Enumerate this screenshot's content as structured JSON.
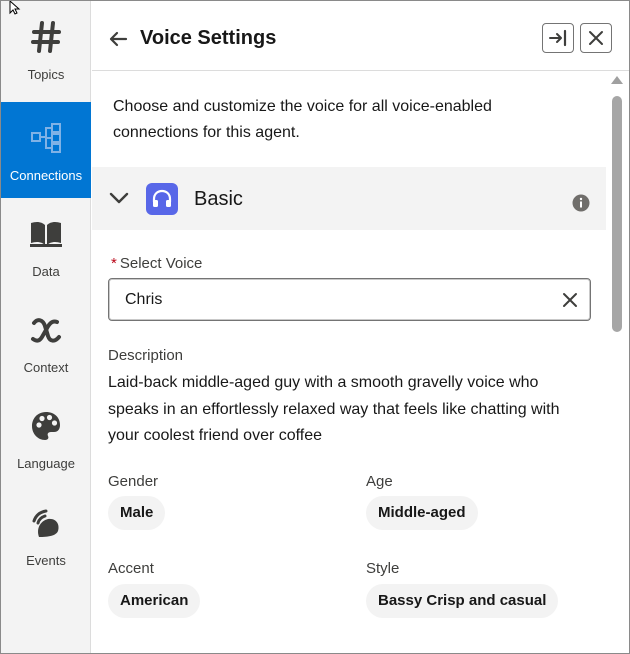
{
  "rail": {
    "items": [
      {
        "label": "Topics",
        "icon": "hash-icon",
        "active": false
      },
      {
        "label": "Connections",
        "icon": "connections-icon",
        "active": true
      },
      {
        "label": "Data",
        "icon": "book-icon",
        "active": false
      },
      {
        "label": "Context",
        "icon": "variable-x-icon",
        "active": false
      },
      {
        "label": "Language",
        "icon": "palette-icon",
        "active": false
      },
      {
        "label": "Events",
        "icon": "signal-icon",
        "active": false
      }
    ]
  },
  "header": {
    "title": "Voice Settings",
    "back_icon": "arrow-left-icon",
    "dock_icon": "dock-right-icon",
    "close_icon": "close-icon"
  },
  "intro": "Choose and customize the voice for all voice-enabled connections for this agent.",
  "section": {
    "title": "Basic",
    "icon": "headphones-icon",
    "icon_color": "#5867e8"
  },
  "select_voice": {
    "required_mark": "*",
    "label": "Select Voice",
    "value": "Chris"
  },
  "description": {
    "label": "Description",
    "text": "Laid-back middle-aged guy with a smooth gravelly voice who speaks in an effortlessly relaxed way that feels like chatting with your coolest friend over coffee"
  },
  "attributes": {
    "gender": {
      "label": "Gender",
      "value": "Male"
    },
    "age": {
      "label": "Age",
      "value": "Middle-aged"
    },
    "accent": {
      "label": "Accent",
      "value": "American"
    },
    "style": {
      "label": "Style",
      "value": "Bassy Crisp and casual"
    }
  },
  "colors": {
    "active": "#0176d3",
    "rail_bg": "#f3f3f3",
    "required": "#ba0517"
  }
}
